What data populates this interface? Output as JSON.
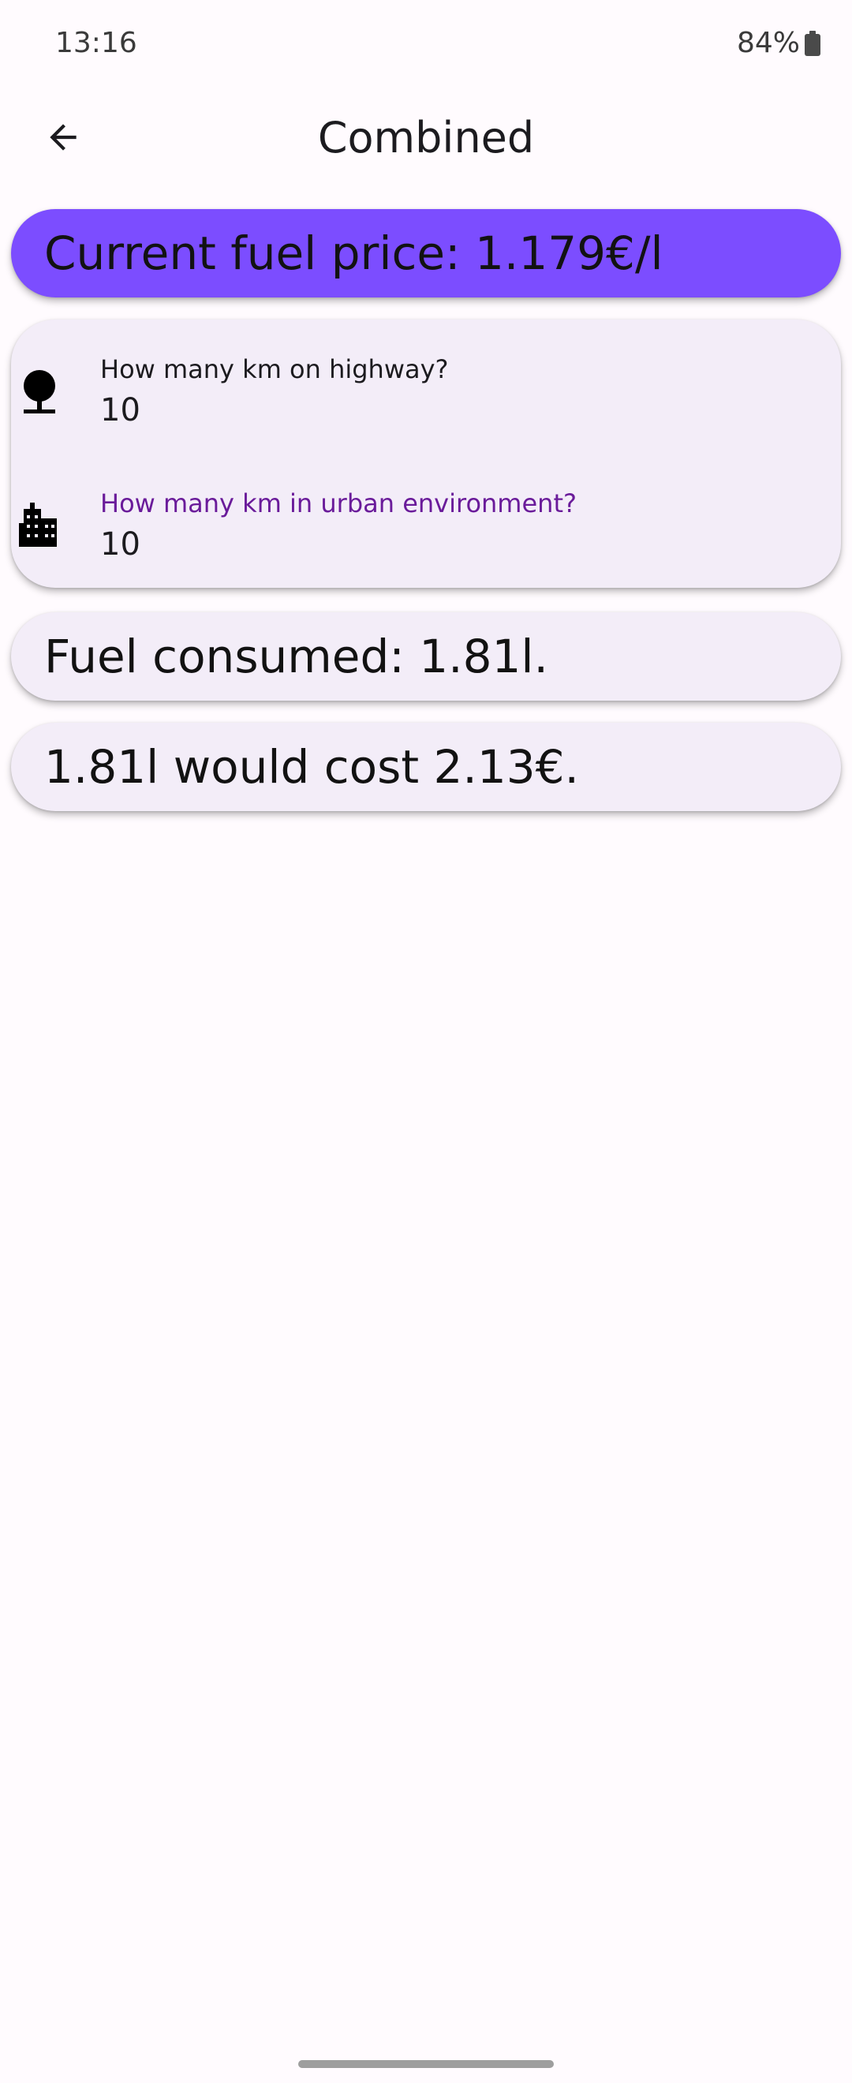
{
  "status_bar": {
    "time": "13:16",
    "battery": "84%"
  },
  "app_bar": {
    "title": "Combined",
    "back_icon": "arrow-back-icon"
  },
  "price_card": {
    "text": "Current fuel price: 1.179€/l",
    "color": "#7c4dff"
  },
  "inputs": {
    "highway": {
      "label": "How many km on highway?",
      "value": "10",
      "icon": "tree-icon",
      "label_color": "#1c1b1f"
    },
    "urban": {
      "label": "How many km in urban environment?",
      "value": "10",
      "icon": "city-icon",
      "label_color": "#6a1b9a",
      "focused": true
    }
  },
  "results": {
    "fuel_consumed": "Fuel consumed: 1.81l.",
    "cost": "1.81l would cost 2.13€."
  },
  "colors": {
    "accent": "#7c4dff",
    "card_background": "#f3edf8",
    "background": "#fffbfe",
    "focused_label": "#6a1b9a"
  }
}
